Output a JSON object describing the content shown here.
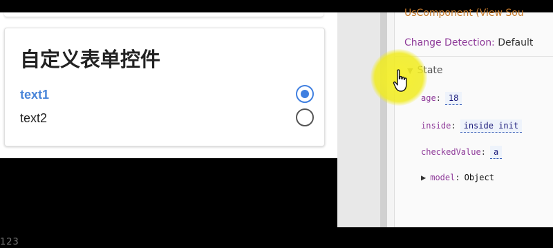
{
  "card": {
    "title": "自定义表单控件",
    "options": [
      {
        "label": "text1",
        "selected": true
      },
      {
        "label": "text2",
        "selected": false
      }
    ]
  },
  "devtools": {
    "component_partial": "UsComponent (View Sou",
    "change_detection_label": "Change Detection:",
    "change_detection_value": "Default",
    "state_label": "State",
    "props": [
      {
        "key": "age",
        "value": "18"
      },
      {
        "key": "inside",
        "value": "inside init"
      },
      {
        "key": "checkedValue",
        "value": "a"
      }
    ],
    "model_key": "model",
    "model_value": "Object"
  },
  "bottom_partial": "123",
  "colors": {
    "accent": "#3f7fe0",
    "selected_text": "#4a86d9",
    "key_purple": "#8e3a99",
    "highlight": "#f5f028"
  },
  "icons": [
    "radio-checked-icon",
    "radio-unchecked-icon",
    "expand-down-icon",
    "collapse-right-icon",
    "hand-pointer-icon"
  ]
}
